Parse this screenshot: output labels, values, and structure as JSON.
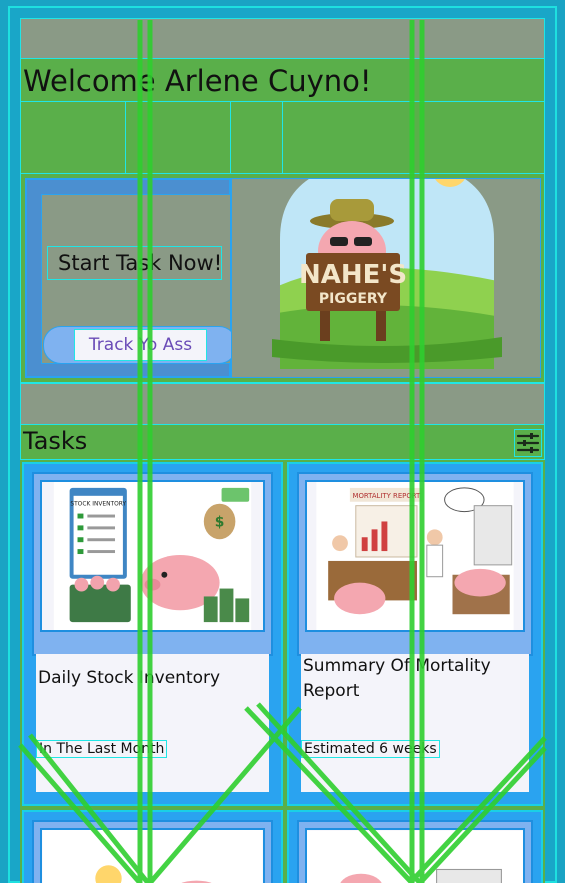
{
  "welcome": {
    "text": "Welcome Arlene Cuyno!"
  },
  "hero": {
    "start_label": "Start Task Now!",
    "track_label": "Track Yo Ass",
    "logo": {
      "line1": "NAHE'S",
      "line2": "PIGGERY"
    }
  },
  "tasks": {
    "title": "Tasks",
    "filter_icon": "sliders-icon",
    "items": [
      {
        "name": "Daily Stock Inventory",
        "meta": "In The Last Month",
        "art_text": "STOCK INVENTORY"
      },
      {
        "name": "Summary Of Mortality Report",
        "meta": "Estimated 6 weeks",
        "art_text": "MORTALITY REPORT"
      }
    ]
  },
  "colors": {
    "frame": "#1aa3c4",
    "panel": "#5aaf4a",
    "card": "#2aa3f0",
    "accent_line": "#33cc33"
  }
}
